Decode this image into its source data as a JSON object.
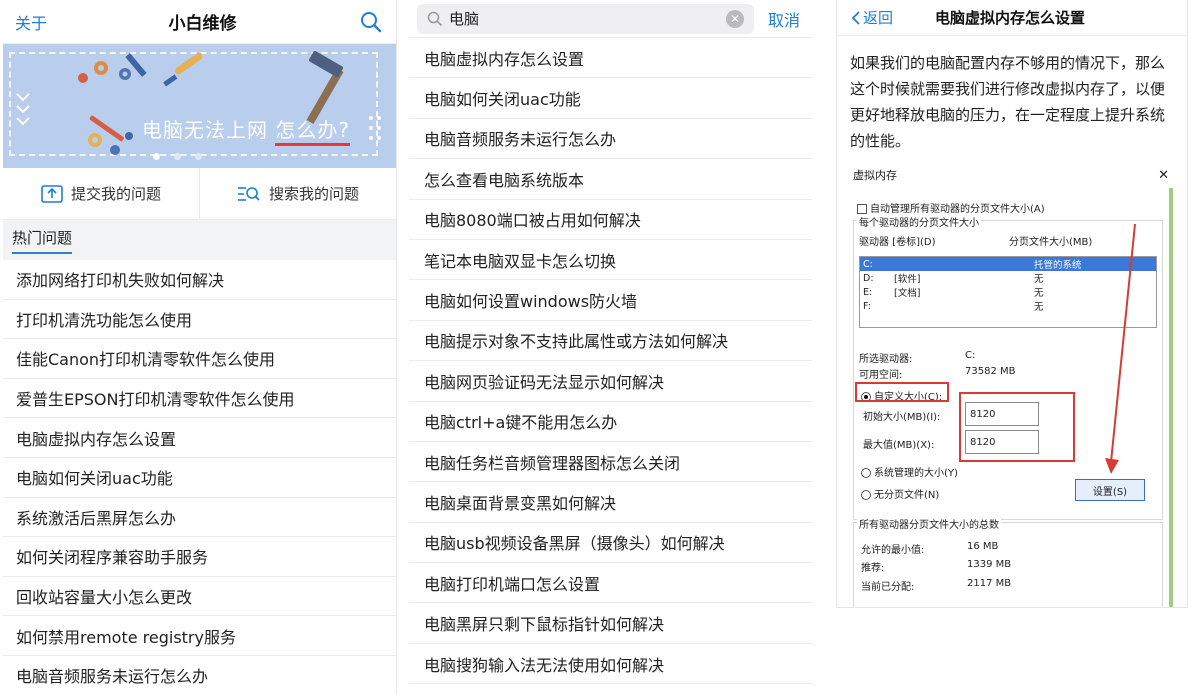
{
  "panel1": {
    "about_label": "关于",
    "title": "小白维修",
    "banner": {
      "text_main": "电脑无法上网 ",
      "text_highlight": "怎么办?"
    },
    "actions": [
      {
        "label": "提交我的问题",
        "icon": "upload-icon"
      },
      {
        "label": "搜索我的问题",
        "icon": "list-search-icon"
      }
    ],
    "hot_title": "热门问题",
    "hot_items": [
      "添加网络打印机失败如何解决",
      "打印机清洗功能怎么使用",
      "佳能Canon打印机清零软件怎么使用",
      "爱普生EPSON打印机清零软件怎么使用",
      "电脑虚拟内存怎么设置",
      "电脑如何关闭uac功能",
      "系统激活后黑屏怎么办",
      "如何关闭程序兼容助手服务",
      "回收站容量大小怎么更改",
      "如何禁用remote registry服务",
      "电脑音频服务未运行怎么办"
    ]
  },
  "panel2": {
    "search_value": "电脑",
    "cancel_label": "取消",
    "results": [
      "电脑虚拟内存怎么设置",
      "电脑如何关闭uac功能",
      "电脑音频服务未运行怎么办",
      "怎么查看电脑系统版本",
      "电脑8080端口被占用如何解决",
      "笔记本电脑双显卡怎么切换",
      "电脑如何设置windows防火墙",
      "电脑提示对象不支持此属性或方法如何解决",
      "电脑网页验证码无法显示如何解决",
      "电脑ctrl+a键不能用怎么办",
      "电脑任务栏音频管理器图标怎么关闭",
      "电脑桌面背景变黑如何解决",
      "电脑usb视频设备黑屏（摄像头）如何解决",
      "电脑打印机端口怎么设置",
      "电脑黑屏只剩下鼠标指针如何解决",
      "电脑搜狗输入法无法使用如何解决"
    ]
  },
  "panel3": {
    "back_label": "返回",
    "title": "电脑虚拟内存怎么设置",
    "body_lines": [
      "如果我们的电脑配置内存不够用的情况下，那么",
      "这个时候就需要我们进行修改虚拟内存了，以便",
      "更好地释放电脑的压力，在一定程度上提升系统",
      "的性能。"
    ],
    "dialog": {
      "title": "虚拟内存",
      "auto_manage": "自动管理所有驱动器的分页文件大小(A)",
      "per_drive_group": "每个驱动器的分页文件大小",
      "col_drive": "驱动器 [卷标](D)",
      "col_pagefile": "分页文件大小(MB)",
      "drives": [
        {
          "drive": "C:",
          "label": "",
          "size": "托管的系统"
        },
        {
          "drive": "D:",
          "label": "[软件]",
          "size": "无"
        },
        {
          "drive": "E:",
          "label": "[文档]",
          "size": "无"
        },
        {
          "drive": "F:",
          "label": "",
          "size": "无"
        }
      ],
      "selected_drive_label": "所选驱动器:",
      "selected_drive_value": "C:",
      "free_space_label": "可用空间:",
      "free_space_value": "73582 MB",
      "custom_size": "自定义大小(C):",
      "initial_size_label": "初始大小(MB)(I):",
      "initial_size_value": "8120",
      "max_size_label": "最大值(MB)(X):",
      "max_size_value": "8120",
      "system_managed": "系统管理的大小(Y)",
      "no_paging": "无分页文件(N)",
      "set_button": "设置(S)",
      "total_group": "所有驱动器分页文件大小的总数",
      "min_allowed_label": "允许的最小值:",
      "min_allowed_value": "16 MB",
      "recommended_label": "推荐:",
      "recommended_value": "1339 MB",
      "allocated_label": "当前已分配:",
      "allocated_value": "2117 MB"
    }
  },
  "colors": {
    "link_blue": "#1f7ed6",
    "banner_bg": "#b9cdec",
    "highlight_red": "#d83a34",
    "separator": "#ececec"
  }
}
